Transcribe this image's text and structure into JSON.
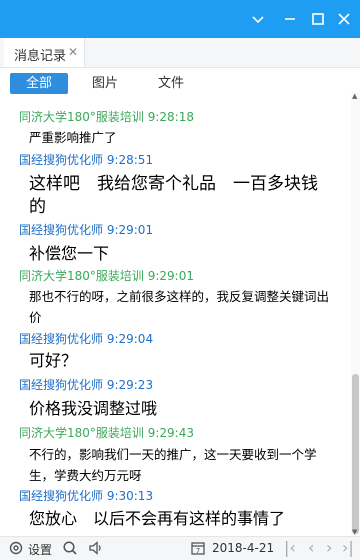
{
  "tab": {
    "label": "消息记录",
    "close_icon": "close-icon"
  },
  "filters": [
    "全部",
    "图片",
    "文件"
  ],
  "messages": [
    {
      "sender": "同济大学180°服装培训 9:28:18",
      "text": "严重影响推广了"
    },
    {
      "sender": "国经搜狗优化师 9:28:51",
      "text": "这样吧　我给您寄个礼品　一百多块钱的"
    },
    {
      "sender": "国经搜狗优化师 9:29:01",
      "text": "补偿您一下"
    },
    {
      "sender": "同济大学180°服装培训 9:29:01",
      "text": "那也不行的呀，之前很多这样的，我反复调整关键词出价"
    },
    {
      "sender": "国经搜狗优化师 9:29:04",
      "text": "可好？"
    },
    {
      "sender": "国经搜狗优化师 9:29:23",
      "text": "价格我没调整过哦"
    },
    {
      "sender": "同济大学180°服装培训 9:29:43",
      "text": "不行的，影响我们一天的推广，这一天要收到一个学生，学费大约万元呀"
    },
    {
      "sender": "国经搜狗优化师 9:30:13",
      "text": "您放心　以后不会再有这样的事情了"
    }
  ],
  "bottom": {
    "settings_label": "设置",
    "date": "2018-4-21"
  },
  "colors": {
    "titlebar": "#1e9df2",
    "sender_self": "#3aa85b",
    "sender_other": "#1f6fc9",
    "active_filter": "#2e8ddd"
  }
}
